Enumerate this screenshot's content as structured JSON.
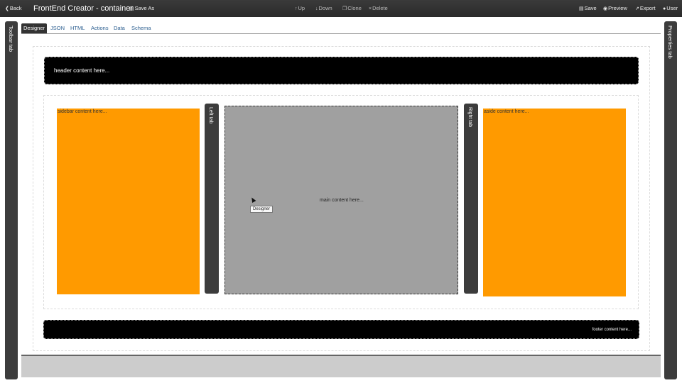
{
  "toolbar": {
    "back_label": "Back",
    "title": "FrontEnd Creator - container",
    "save_as_label": "Save As",
    "up_label": "Up",
    "down_label": "Down",
    "clone_label": "Clone",
    "delete_label": "Delete",
    "save_label": "Save",
    "preview_label": "Preview",
    "export_label": "Export",
    "user_label": "User"
  },
  "side_tabs": {
    "left": "Toolbar tab",
    "right": "Properties tab"
  },
  "designer_tabs": [
    {
      "label": "Designer",
      "active": true
    },
    {
      "label": "JSON",
      "active": false
    },
    {
      "label": "HTML",
      "active": false
    },
    {
      "label": "Actions",
      "active": false
    },
    {
      "label": "Data",
      "active": false
    },
    {
      "label": "Schema",
      "active": false
    }
  ],
  "canvas": {
    "header_text": "header content here...",
    "sidebar_text": "sidebar content here...",
    "left_tab": "Left tab",
    "main_text": "main content here...",
    "right_tab": "Right tab",
    "aside_text": "aside content here...",
    "footer_text": "footer content here...",
    "tooltip_text": "Designer"
  },
  "colors": {
    "topbar": "#2e2e2e",
    "side_tab": "#3c3c3c",
    "orange": "#ff9a00",
    "main_gray": "#a0a0a0",
    "tab_link": "#2a5d8f"
  },
  "icons": {
    "back": "chevron-left-icon",
    "save_as": "save-icon",
    "up": "arrow-up-icon",
    "down": "arrow-down-icon",
    "clone": "clone-icon",
    "delete": "close-icon",
    "save": "save-icon",
    "preview": "eye-icon",
    "export": "export-icon",
    "user": "user-icon"
  }
}
